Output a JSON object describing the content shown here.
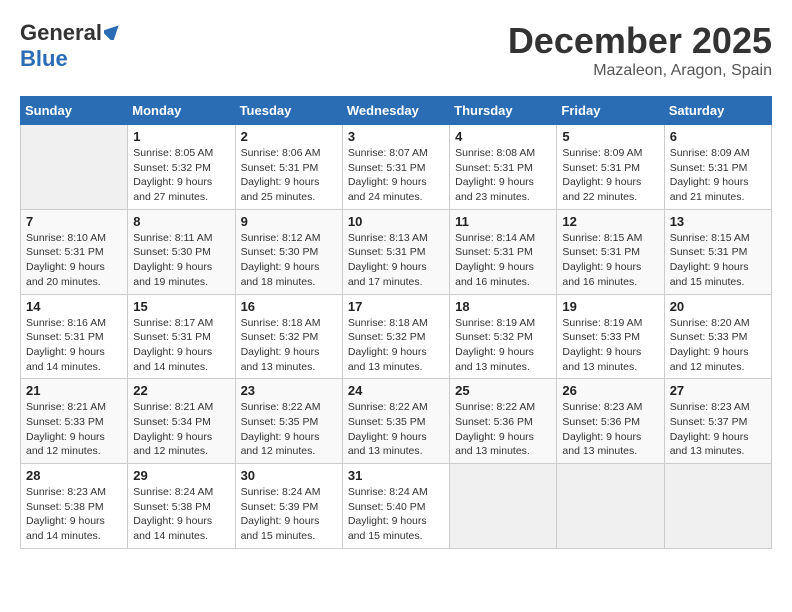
{
  "logo": {
    "general": "General",
    "blue": "Blue"
  },
  "title": "December 2025",
  "location": "Mazaleon, Aragon, Spain",
  "days_of_week": [
    "Sunday",
    "Monday",
    "Tuesday",
    "Wednesday",
    "Thursday",
    "Friday",
    "Saturday"
  ],
  "weeks": [
    [
      {
        "num": "",
        "info": ""
      },
      {
        "num": "1",
        "sunrise": "Sunrise: 8:05 AM",
        "sunset": "Sunset: 5:32 PM",
        "daylight": "Daylight: 9 hours and 27 minutes."
      },
      {
        "num": "2",
        "sunrise": "Sunrise: 8:06 AM",
        "sunset": "Sunset: 5:31 PM",
        "daylight": "Daylight: 9 hours and 25 minutes."
      },
      {
        "num": "3",
        "sunrise": "Sunrise: 8:07 AM",
        "sunset": "Sunset: 5:31 PM",
        "daylight": "Daylight: 9 hours and 24 minutes."
      },
      {
        "num": "4",
        "sunrise": "Sunrise: 8:08 AM",
        "sunset": "Sunset: 5:31 PM",
        "daylight": "Daylight: 9 hours and 23 minutes."
      },
      {
        "num": "5",
        "sunrise": "Sunrise: 8:09 AM",
        "sunset": "Sunset: 5:31 PM",
        "daylight": "Daylight: 9 hours and 22 minutes."
      },
      {
        "num": "6",
        "sunrise": "Sunrise: 8:09 AM",
        "sunset": "Sunset: 5:31 PM",
        "daylight": "Daylight: 9 hours and 21 minutes."
      }
    ],
    [
      {
        "num": "7",
        "sunrise": "Sunrise: 8:10 AM",
        "sunset": "Sunset: 5:31 PM",
        "daylight": "Daylight: 9 hours and 20 minutes."
      },
      {
        "num": "8",
        "sunrise": "Sunrise: 8:11 AM",
        "sunset": "Sunset: 5:30 PM",
        "daylight": "Daylight: 9 hours and 19 minutes."
      },
      {
        "num": "9",
        "sunrise": "Sunrise: 8:12 AM",
        "sunset": "Sunset: 5:30 PM",
        "daylight": "Daylight: 9 hours and 18 minutes."
      },
      {
        "num": "10",
        "sunrise": "Sunrise: 8:13 AM",
        "sunset": "Sunset: 5:31 PM",
        "daylight": "Daylight: 9 hours and 17 minutes."
      },
      {
        "num": "11",
        "sunrise": "Sunrise: 8:14 AM",
        "sunset": "Sunset: 5:31 PM",
        "daylight": "Daylight: 9 hours and 16 minutes."
      },
      {
        "num": "12",
        "sunrise": "Sunrise: 8:15 AM",
        "sunset": "Sunset: 5:31 PM",
        "daylight": "Daylight: 9 hours and 16 minutes."
      },
      {
        "num": "13",
        "sunrise": "Sunrise: 8:15 AM",
        "sunset": "Sunset: 5:31 PM",
        "daylight": "Daylight: 9 hours and 15 minutes."
      }
    ],
    [
      {
        "num": "14",
        "sunrise": "Sunrise: 8:16 AM",
        "sunset": "Sunset: 5:31 PM",
        "daylight": "Daylight: 9 hours and 14 minutes."
      },
      {
        "num": "15",
        "sunrise": "Sunrise: 8:17 AM",
        "sunset": "Sunset: 5:31 PM",
        "daylight": "Daylight: 9 hours and 14 minutes."
      },
      {
        "num": "16",
        "sunrise": "Sunrise: 8:18 AM",
        "sunset": "Sunset: 5:32 PM",
        "daylight": "Daylight: 9 hours and 13 minutes."
      },
      {
        "num": "17",
        "sunrise": "Sunrise: 8:18 AM",
        "sunset": "Sunset: 5:32 PM",
        "daylight": "Daylight: 9 hours and 13 minutes."
      },
      {
        "num": "18",
        "sunrise": "Sunrise: 8:19 AM",
        "sunset": "Sunset: 5:32 PM",
        "daylight": "Daylight: 9 hours and 13 minutes."
      },
      {
        "num": "19",
        "sunrise": "Sunrise: 8:19 AM",
        "sunset": "Sunset: 5:33 PM",
        "daylight": "Daylight: 9 hours and 13 minutes."
      },
      {
        "num": "20",
        "sunrise": "Sunrise: 8:20 AM",
        "sunset": "Sunset: 5:33 PM",
        "daylight": "Daylight: 9 hours and 12 minutes."
      }
    ],
    [
      {
        "num": "21",
        "sunrise": "Sunrise: 8:21 AM",
        "sunset": "Sunset: 5:33 PM",
        "daylight": "Daylight: 9 hours and 12 minutes."
      },
      {
        "num": "22",
        "sunrise": "Sunrise: 8:21 AM",
        "sunset": "Sunset: 5:34 PM",
        "daylight": "Daylight: 9 hours and 12 minutes."
      },
      {
        "num": "23",
        "sunrise": "Sunrise: 8:22 AM",
        "sunset": "Sunset: 5:35 PM",
        "daylight": "Daylight: 9 hours and 12 minutes."
      },
      {
        "num": "24",
        "sunrise": "Sunrise: 8:22 AM",
        "sunset": "Sunset: 5:35 PM",
        "daylight": "Daylight: 9 hours and 13 minutes."
      },
      {
        "num": "25",
        "sunrise": "Sunrise: 8:22 AM",
        "sunset": "Sunset: 5:36 PM",
        "daylight": "Daylight: 9 hours and 13 minutes."
      },
      {
        "num": "26",
        "sunrise": "Sunrise: 8:23 AM",
        "sunset": "Sunset: 5:36 PM",
        "daylight": "Daylight: 9 hours and 13 minutes."
      },
      {
        "num": "27",
        "sunrise": "Sunrise: 8:23 AM",
        "sunset": "Sunset: 5:37 PM",
        "daylight": "Daylight: 9 hours and 13 minutes."
      }
    ],
    [
      {
        "num": "28",
        "sunrise": "Sunrise: 8:23 AM",
        "sunset": "Sunset: 5:38 PM",
        "daylight": "Daylight: 9 hours and 14 minutes."
      },
      {
        "num": "29",
        "sunrise": "Sunrise: 8:24 AM",
        "sunset": "Sunset: 5:38 PM",
        "daylight": "Daylight: 9 hours and 14 minutes."
      },
      {
        "num": "30",
        "sunrise": "Sunrise: 8:24 AM",
        "sunset": "Sunset: 5:39 PM",
        "daylight": "Daylight: 9 hours and 15 minutes."
      },
      {
        "num": "31",
        "sunrise": "Sunrise: 8:24 AM",
        "sunset": "Sunset: 5:40 PM",
        "daylight": "Daylight: 9 hours and 15 minutes."
      },
      {
        "num": "",
        "info": ""
      },
      {
        "num": "",
        "info": ""
      },
      {
        "num": "",
        "info": ""
      }
    ]
  ]
}
